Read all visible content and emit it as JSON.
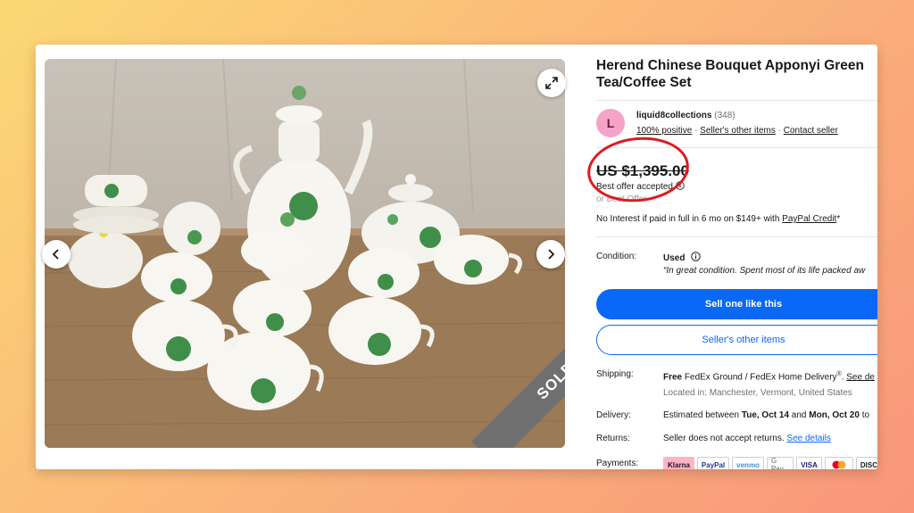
{
  "listing": {
    "title": "Herend Chinese Bouquet Apponyi Green Tea/Coffee Set",
    "sold_label": "SOLD"
  },
  "seller": {
    "avatar_letter": "L",
    "name": "liquid8collections",
    "feedback_count": "(348)",
    "positive": "100% positive",
    "other_items_link": "Seller's other items",
    "contact_link": "Contact seller"
  },
  "price": {
    "amount": "US $1,395.00",
    "best_offer": "Best offer accepted",
    "best_offer_sub": "or Best Offer",
    "paypal_text": "No Interest if paid in full in 6 mo on $149+ with",
    "paypal_link": "PayPal Credit",
    "paypal_suffix": "*"
  },
  "condition": {
    "label": "Condition:",
    "value": "Used",
    "note": "“In great condition. Spent most of its life packed aw"
  },
  "buttons": {
    "sell_one": "Sell one like this",
    "seller_items": "Seller's other items"
  },
  "shipping": {
    "label": "Shipping:",
    "free": "Free",
    "method": "FedEx Ground / FedEx Home Delivery",
    "reg": "®",
    "see_details": "See de",
    "location": "Located in: Manchester, Vermont, United States"
  },
  "delivery": {
    "label": "Delivery:",
    "prefix": "Estimated between",
    "start": "Tue, Oct 14",
    "and": "and",
    "end": "Mon, Oct 20",
    "suffix": "to"
  },
  "returns": {
    "label": "Returns:",
    "text": "Seller does not accept returns.",
    "link": "See details"
  },
  "payments": {
    "label": "Payments:",
    "methods": [
      "Klarna",
      "PayPal",
      "venmo",
      "G Pay",
      "VISA",
      "MC",
      "DISC"
    ]
  },
  "colors": {
    "accent_blue": "#0968f6",
    "annotation_red": "#e0191f",
    "klarna_pink": "#ffb3c7"
  },
  "icons": {
    "expand": "expand-icon",
    "prev": "chevron-left-icon",
    "next": "chevron-right-icon",
    "info": "info-icon"
  }
}
